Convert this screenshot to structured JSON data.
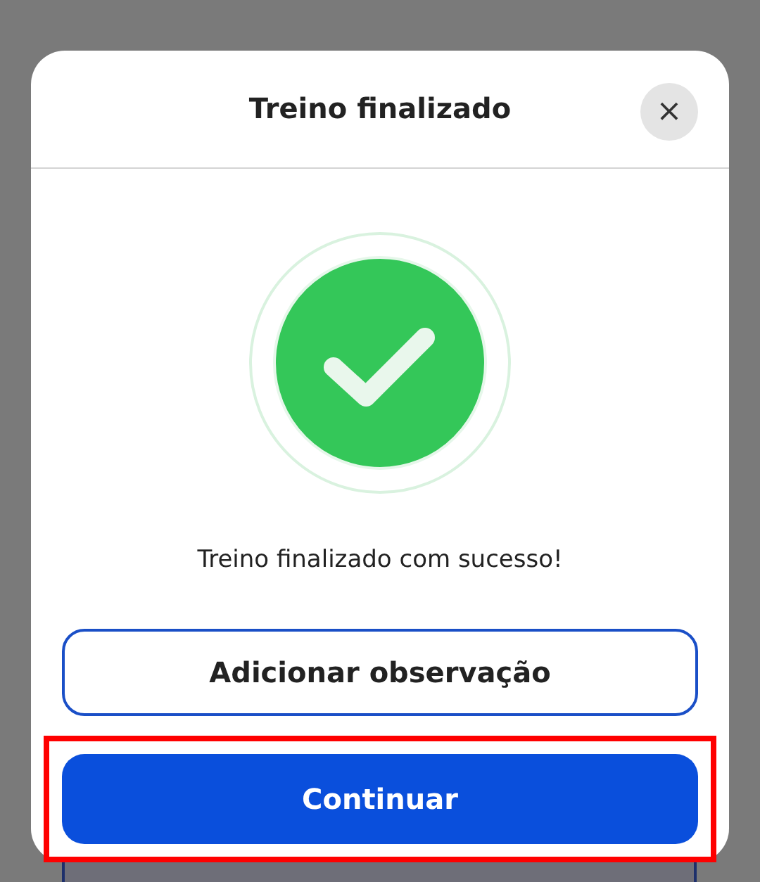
{
  "dialog": {
    "title": "Treino finalizado",
    "close": "×"
  },
  "status": {
    "kind": "success",
    "message": "Treino finalizado com sucesso!"
  },
  "buttons": [
    {
      "label": "Adicionar observação",
      "kind": "outline",
      "highlighted": false
    },
    {
      "label": "Continuar",
      "kind": "primary",
      "highlighted": true
    }
  ]
}
